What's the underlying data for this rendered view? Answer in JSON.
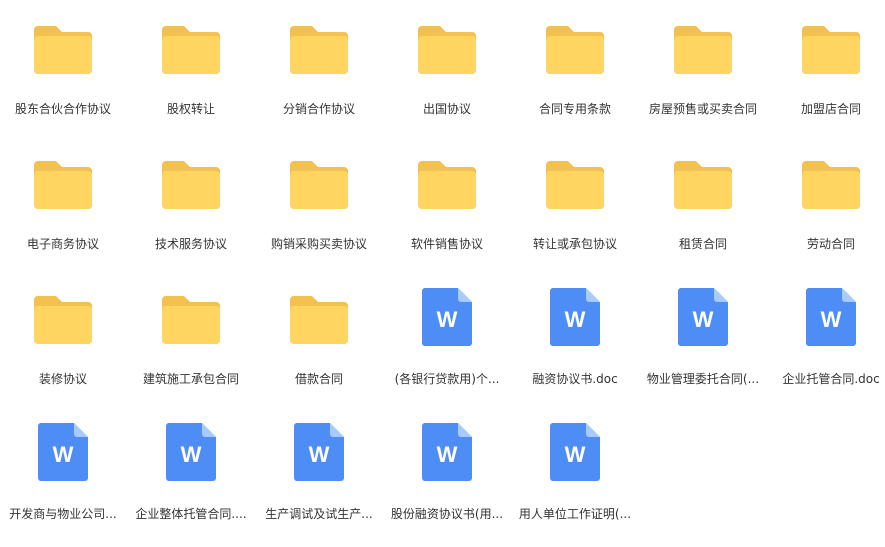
{
  "colors": {
    "folder_back": "#F2C14E",
    "folder_front": "#FFD561",
    "doc_body": "#4E8DF5",
    "doc_fold": "#A9CBFB",
    "doc_letter": "#FFFFFF",
    "label_text": "#333333"
  },
  "icons": {
    "folder": "folder-icon",
    "document": "word-document-icon",
    "document_letter": "W"
  },
  "items": [
    {
      "type": "folder",
      "label": "股东合伙合作协议"
    },
    {
      "type": "folder",
      "label": "股权转让"
    },
    {
      "type": "folder",
      "label": "分销合作协议"
    },
    {
      "type": "folder",
      "label": "出国协议"
    },
    {
      "type": "folder",
      "label": "合同专用条款"
    },
    {
      "type": "folder",
      "label": "房屋预售或买卖合同"
    },
    {
      "type": "folder",
      "label": "加盟店合同"
    },
    {
      "type": "folder",
      "label": "电子商务协议"
    },
    {
      "type": "folder",
      "label": "技术服务协议"
    },
    {
      "type": "folder",
      "label": "购销采购买卖协议"
    },
    {
      "type": "folder",
      "label": "软件销售协议"
    },
    {
      "type": "folder",
      "label": "转让或承包协议"
    },
    {
      "type": "folder",
      "label": "租赁合同"
    },
    {
      "type": "folder",
      "label": "劳动合同"
    },
    {
      "type": "folder",
      "label": "装修协议"
    },
    {
      "type": "folder",
      "label": "建筑施工承包合同"
    },
    {
      "type": "folder",
      "label": "借款合同"
    },
    {
      "type": "document",
      "label": "(各银行贷款用)个..."
    },
    {
      "type": "document",
      "label": "融资协议书.doc"
    },
    {
      "type": "document",
      "label": "物业管理委托合同(..."
    },
    {
      "type": "document",
      "label": "企业托管合同.doc"
    },
    {
      "type": "document",
      "label": "开发商与物业公司..."
    },
    {
      "type": "document",
      "label": "企业整体托管合同...."
    },
    {
      "type": "document",
      "label": "生产调试及试生产..."
    },
    {
      "type": "document",
      "label": "股份融资协议书(用..."
    },
    {
      "type": "document",
      "label": "用人单位工作证明(..."
    }
  ]
}
